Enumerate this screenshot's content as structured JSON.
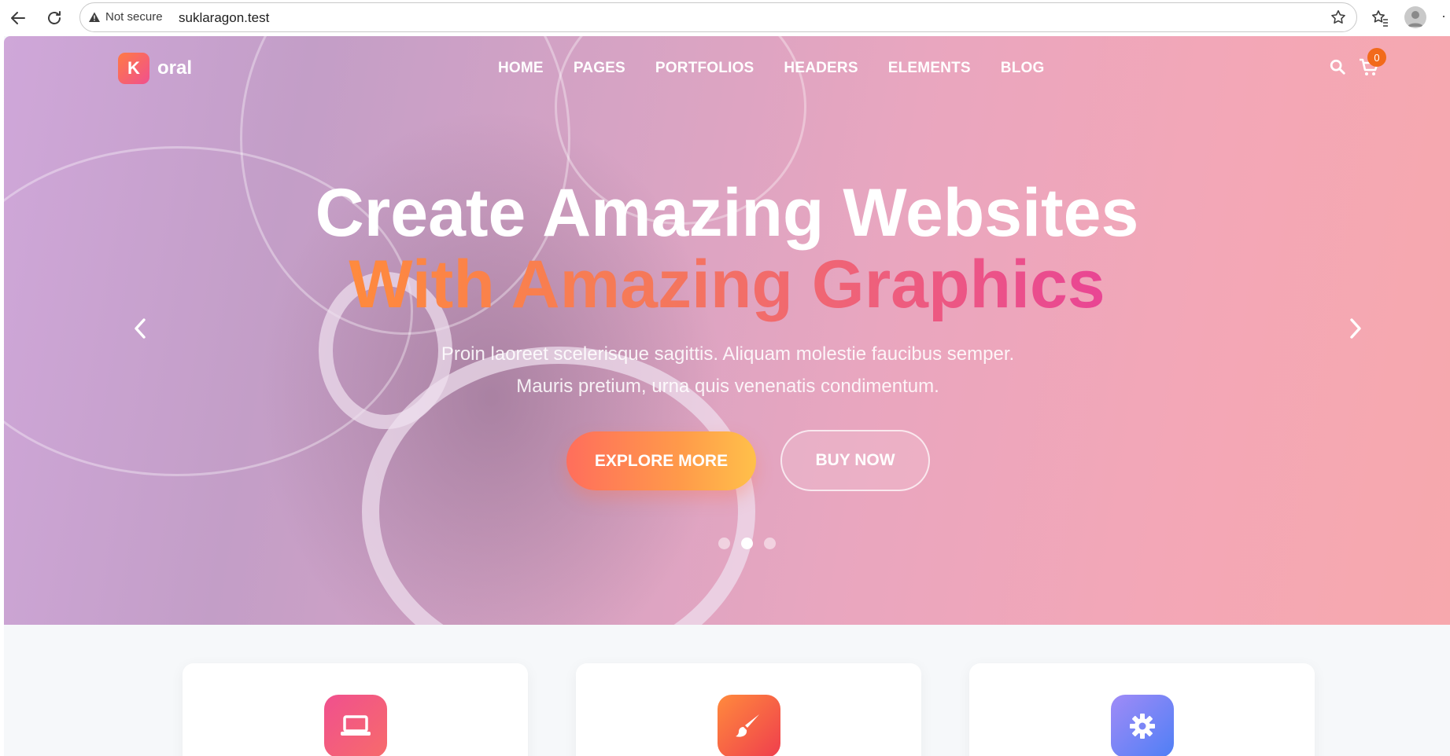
{
  "browser": {
    "security_label": "Not secure",
    "url": "suklaragon.test",
    "icons": [
      "back-arrow-icon",
      "reload-icon",
      "warning-icon",
      "star-icon",
      "favorites-icon",
      "profile-icon",
      "more-icon"
    ]
  },
  "site": {
    "logo_letter": "K",
    "logo_word": "oral",
    "nav": [
      "HOME",
      "PAGES",
      "PORTFOLIOS",
      "HEADERS",
      "ELEMENTS",
      "BLOG"
    ],
    "cart_count": "0"
  },
  "hero": {
    "headline_line1": "Create Amazing Websites",
    "headline_line2": "With Amazing Graphics",
    "subtext": "Proin laoreet scelerisque sagittis. Aliquam molestie faucibus semper. Mauris pretium, urna quis venenatis condimentum.",
    "primary_button": "EXPLORE MORE",
    "secondary_button": "BUY NOW",
    "slides_total": 3,
    "active_slide": 2
  },
  "features": [
    {
      "icon": "laptop-icon",
      "color_from": "#f0508e",
      "color_to": "#f76b6b"
    },
    {
      "icon": "brush-icon",
      "color_from": "#ff8a3d",
      "color_to": "#ef3e4d"
    },
    {
      "icon": "gear-icon",
      "color_from": "#a08bf7",
      "color_to": "#4f7ff5"
    }
  ],
  "colors": {
    "accent_orange": "#ff8a3d",
    "accent_pink": "#e94594",
    "cart_badge": "#f26a1b"
  }
}
